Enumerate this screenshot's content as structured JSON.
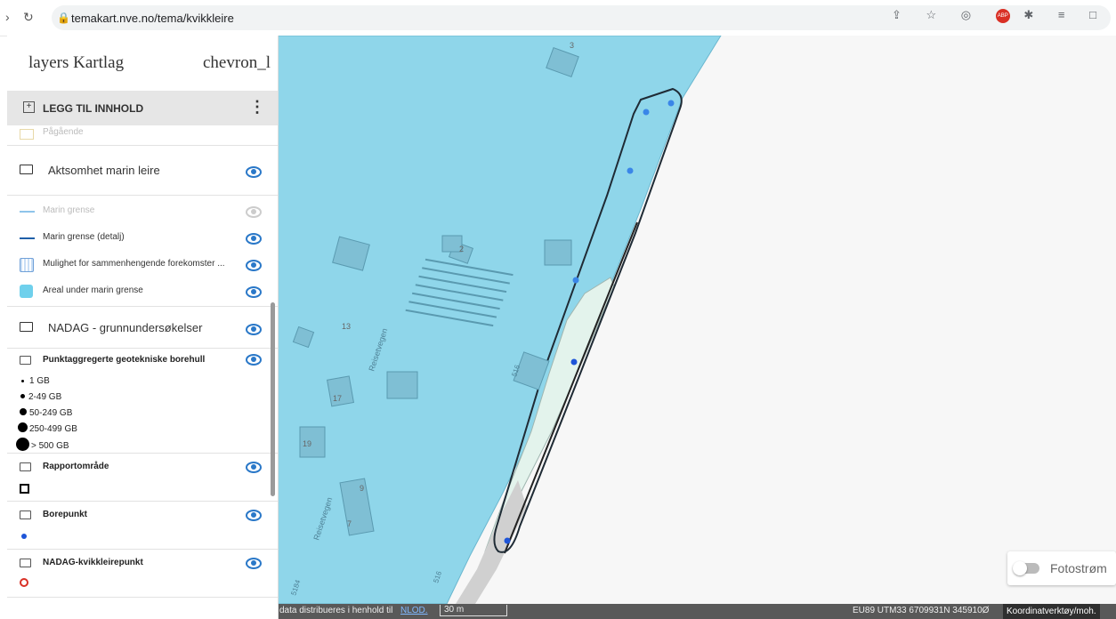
{
  "browser": {
    "url": "temakart.nve.no/tema/kvikkleire"
  },
  "panel": {
    "header_icon_text": "layers",
    "title": "Kartlag",
    "header_right_text": "chevron_l",
    "add_content_label": "LEGG TIL INNHOLD",
    "partial_item": "Pågående",
    "groups": [
      {
        "label": "Aktsomhet marin leire"
      },
      {
        "label": "NADAG - grunnundersøkelser"
      }
    ],
    "marine_items": [
      {
        "label": "Marin grense"
      },
      {
        "label": "Marin grense (detalj)"
      },
      {
        "label": "Mulighet for sammenhengende forekomster ..."
      },
      {
        "label": "Areal under marin grense"
      }
    ],
    "punkt_title": "Punktaggregerte geotekniske borehull",
    "punkt_legend": [
      "1 GB",
      "2-49 GB",
      "50-249 GB",
      "250-499 GB",
      "> 500 GB"
    ],
    "rapport_title": "Rapportområde",
    "borepunkt_title": "Borepunkt",
    "kvikk_title": "NADAG-kvikkleirepunkt"
  },
  "map": {
    "house_numbers": [
      "3",
      "2",
      "13",
      "17",
      "19",
      "9",
      "7"
    ],
    "road_labels": [
      "Reisetvegen",
      "Reisetvegen"
    ],
    "road_numbers": [
      "516",
      "516",
      "5184"
    ],
    "fotostrom_label": "Fotostrøm",
    "attribution_prefix": "data distribueres i henhold til",
    "attribution_link": "NLOD.",
    "scale_label": "30 m",
    "coordinates": "EU89 UTM33 6709931N 345910Ø",
    "coord_tool": "Koordinatverktøy/moh."
  },
  "colors": {
    "water": "#8fd6ea",
    "accent_blue": "#2a78c8",
    "point_blue": "#3a86e8",
    "red": "#d93025"
  }
}
